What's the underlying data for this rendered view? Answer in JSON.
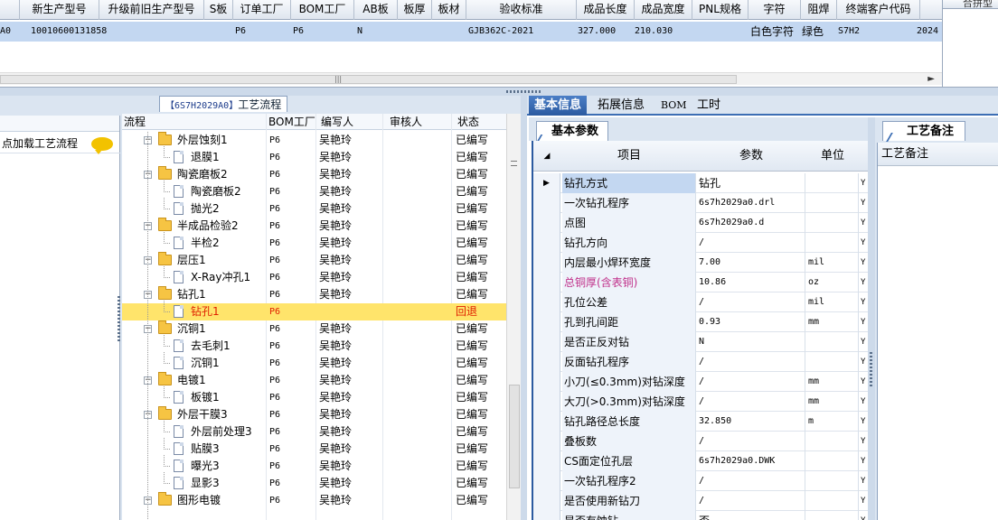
{
  "top_grid": {
    "columns": [
      "新生产型号",
      "升级前旧生产型号",
      "S板",
      "订单工厂",
      "BOM工厂",
      "AB板",
      "板厚",
      "板材",
      "验收标准",
      "成品长度",
      "成品宽度",
      "PNL规格",
      "字符",
      "阻焊",
      "终端客户代码"
    ],
    "row": {
      "row_prefix": "A0",
      "new_model": "10010600131858",
      "old_model": "",
      "s_board": "",
      "order_factory": "P6",
      "bom_factory": "P6",
      "ab_board": "N",
      "thickness": "",
      "material": "",
      "standard": "GJB362C-2021",
      "length": "327.000",
      "width": "210.030",
      "pnl": "",
      "char": "白色字符",
      "mask": "绿色",
      "customer": "S7H2",
      "extra": "2024"
    }
  },
  "right_pane": {
    "header": "合拼型"
  },
  "left_panel": {
    "tab_code": "【6S7H2029A0】",
    "tab_title": "工艺流程",
    "load_label": "点加载工艺流程",
    "tree_headers": {
      "process": "流程",
      "bom": "BOM工厂",
      "writer": "编写人",
      "reviewer": "审核人",
      "status": "状态"
    },
    "rows": [
      {
        "name": "外层蚀刻1",
        "bom": "P6",
        "writer": "吴艳玲",
        "status": "已编写",
        "level": 1
      },
      {
        "name": "退膜1",
        "bom": "P6",
        "writer": "吴艳玲",
        "status": "已编写",
        "level": 2
      },
      {
        "name": "陶瓷磨板2",
        "bom": "P6",
        "writer": "吴艳玲",
        "status": "已编写",
        "level": 1
      },
      {
        "name": "陶瓷磨板2",
        "bom": "P6",
        "writer": "吴艳玲",
        "status": "已编写",
        "level": 2
      },
      {
        "name": "抛光2",
        "bom": "P6",
        "writer": "吴艳玲",
        "status": "已编写",
        "level": 2
      },
      {
        "name": "半成品检验2",
        "bom": "P6",
        "writer": "吴艳玲",
        "status": "已编写",
        "level": 1
      },
      {
        "name": "半检2",
        "bom": "P6",
        "writer": "吴艳玲",
        "status": "已编写",
        "level": 2
      },
      {
        "name": "层压1",
        "bom": "P6",
        "writer": "吴艳玲",
        "status": "已编写",
        "level": 1
      },
      {
        "name": "X-Ray冲孔1",
        "bom": "P6",
        "writer": "吴艳玲",
        "status": "已编写",
        "level": 2
      },
      {
        "name": "钻孔1",
        "bom": "P6",
        "writer": "吴艳玲",
        "status": "已编写",
        "level": 1
      },
      {
        "name": "钻孔1",
        "bom": "P6",
        "writer": "",
        "status": "回退",
        "level": 2,
        "selected": true
      },
      {
        "name": "沉铜1",
        "bom": "P6",
        "writer": "吴艳玲",
        "status": "已编写",
        "level": 1
      },
      {
        "name": "去毛刺1",
        "bom": "P6",
        "writer": "吴艳玲",
        "status": "已编写",
        "level": 2
      },
      {
        "name": "沉铜1",
        "bom": "P6",
        "writer": "吴艳玲",
        "status": "已编写",
        "level": 2
      },
      {
        "name": "电镀1",
        "bom": "P6",
        "writer": "吴艳玲",
        "status": "已编写",
        "level": 1
      },
      {
        "name": "板镀1",
        "bom": "P6",
        "writer": "吴艳玲",
        "status": "已编写",
        "level": 2
      },
      {
        "name": "外层干膜3",
        "bom": "P6",
        "writer": "吴艳玲",
        "status": "已编写",
        "level": 1
      },
      {
        "name": "外层前处理3",
        "bom": "P6",
        "writer": "吴艳玲",
        "status": "已编写",
        "level": 2
      },
      {
        "name": "贴膜3",
        "bom": "P6",
        "writer": "吴艳玲",
        "status": "已编写",
        "level": 2
      },
      {
        "name": "曝光3",
        "bom": "P6",
        "writer": "吴艳玲",
        "status": "已编写",
        "level": 2
      },
      {
        "name": "显影3",
        "bom": "P6",
        "writer": "吴艳玲",
        "status": "已编写",
        "level": 2
      },
      {
        "name": "图形电镀",
        "bom": "P6",
        "writer": "吴艳玲",
        "status": "已编写",
        "level": 1
      }
    ]
  },
  "tabs": [
    "基本信息",
    "拓展信息",
    "BOM",
    "工时"
  ],
  "params_tab": "基本参数",
  "param_headers": {
    "item": "项目",
    "param": "参数",
    "unit": "单位"
  },
  "params": [
    {
      "item": "钻孔方式",
      "value": "钻孔",
      "unit": "",
      "flag": "Y"
    },
    {
      "item": "一次钻孔程序",
      "value": "6s7h2029a0.drl",
      "unit": "",
      "flag": "Y"
    },
    {
      "item": "点图",
      "value": "6s7h2029a0.d",
      "unit": "",
      "flag": "Y"
    },
    {
      "item": "钻孔方向",
      "value": "/",
      "unit": "",
      "flag": "Y"
    },
    {
      "item": "内层最小焊环宽度",
      "value": "7.00",
      "unit": "mil",
      "flag": "Y"
    },
    {
      "item": "总铜厚(含表铜)",
      "value": "10.86",
      "unit": "oz",
      "flag": "Y"
    },
    {
      "item": "孔位公差",
      "value": "/",
      "unit": "mil",
      "flag": "Y"
    },
    {
      "item": "孔到孔间距",
      "value": "0.93",
      "unit": "mm",
      "flag": "Y"
    },
    {
      "item": "是否正反对钻",
      "value": "N",
      "unit": "",
      "flag": "Y"
    },
    {
      "item": "反面钻孔程序",
      "value": "/",
      "unit": "",
      "flag": "Y"
    },
    {
      "item": "小刀(≤0.3mm)对钻深度",
      "value": "/",
      "unit": "mm",
      "flag": "Y"
    },
    {
      "item": "大刀(>0.3mm)对钻深度",
      "value": "/",
      "unit": "mm",
      "flag": "Y"
    },
    {
      "item": "钻孔路径总长度",
      "value": "32.850",
      "unit": "m",
      "flag": "Y"
    },
    {
      "item": "叠板数",
      "value": "/",
      "unit": "",
      "flag": "Y"
    },
    {
      "item": "CS面定位孔层",
      "value": "6s7h2029a0.DWK",
      "unit": "",
      "flag": "Y"
    },
    {
      "item": "一次钻孔程序2",
      "value": "/",
      "unit": "",
      "flag": "Y"
    },
    {
      "item": "是否使用新钻刀",
      "value": "/",
      "unit": "",
      "flag": "Y"
    },
    {
      "item": "是否有蚀钻",
      "value": "否",
      "unit": "",
      "flag": "Y"
    }
  ],
  "notes": {
    "tab": "工艺备注",
    "header": "工艺备注"
  },
  "colors": {
    "accent": "#3c6eb4",
    "selected_row": "#ffe46b",
    "status_back": "#e02000",
    "pink_label": "#c0308a"
  }
}
